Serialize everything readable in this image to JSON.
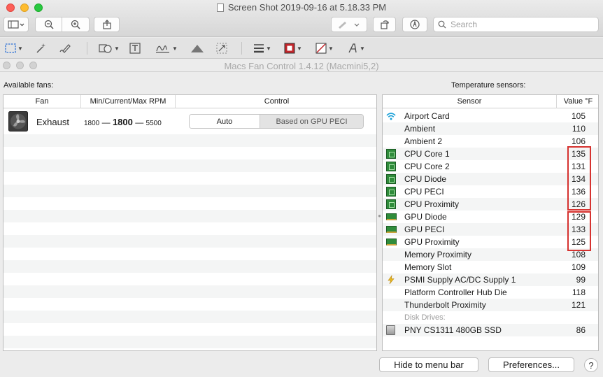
{
  "preview_window": {
    "title": "Screen Shot 2019-09-16 at 5.18.33 PM",
    "search_placeholder": "Search"
  },
  "app": {
    "title": "Macs Fan Control 1.4.12 (Macmini5,2)"
  },
  "fans_panel": {
    "label": "Available fans:",
    "headers": {
      "fan": "Fan",
      "rpm": "Min/Current/Max RPM",
      "control": "Control"
    },
    "fans": [
      {
        "name": "Exhaust",
        "min": "1800",
        "current": "1800",
        "max": "5500",
        "mode_auto": "Auto",
        "mode_sensor": "Based on GPU PECI"
      }
    ],
    "separator": "—"
  },
  "sensors_panel": {
    "label": "Temperature sensors:",
    "headers": {
      "sensor": "Sensor",
      "value": "Value °F"
    },
    "rows": [
      {
        "name": "Airport Card",
        "value": "105",
        "icon": "wifi-icon"
      },
      {
        "name": "Ambient",
        "value": "110",
        "icon": ""
      },
      {
        "name": "Ambient 2",
        "value": "106",
        "icon": ""
      },
      {
        "name": "CPU Core 1",
        "value": "135",
        "icon": "cpu-chip-icon"
      },
      {
        "name": "CPU Core 2",
        "value": "131",
        "icon": "cpu-chip-icon"
      },
      {
        "name": "CPU Diode",
        "value": "134",
        "icon": "cpu-chip-icon"
      },
      {
        "name": "CPU PECI",
        "value": "136",
        "icon": "cpu-chip-icon"
      },
      {
        "name": "CPU Proximity",
        "value": "126",
        "icon": "cpu-chip-icon"
      },
      {
        "name": "GPU Diode",
        "value": "129",
        "icon": "gpu-card-icon"
      },
      {
        "name": "GPU PECI",
        "value": "133",
        "icon": "gpu-card-icon"
      },
      {
        "name": "GPU Proximity",
        "value": "125",
        "icon": "gpu-card-icon"
      },
      {
        "name": "Memory Proximity",
        "value": "108",
        "icon": ""
      },
      {
        "name": "Memory Slot",
        "value": "109",
        "icon": ""
      },
      {
        "name": "PSMI Supply AC/DC Supply 1",
        "value": "99",
        "icon": "lightning-icon"
      },
      {
        "name": "Platform Controller Hub Die",
        "value": "118",
        "icon": ""
      },
      {
        "name": "Thunderbolt Proximity",
        "value": "121",
        "icon": ""
      }
    ],
    "disk_group_label": "Disk Drives:",
    "disk_rows": [
      {
        "name": "PNY CS1311 480GB SSD",
        "value": "86",
        "icon": "ssd-drive-icon"
      }
    ]
  },
  "footer": {
    "hide_button": "Hide to menu bar",
    "preferences_button": "Preferences...",
    "help_button": "?"
  },
  "colors": {
    "highlight_box": "#d6322f",
    "chip_green": "#2f8c3b"
  }
}
